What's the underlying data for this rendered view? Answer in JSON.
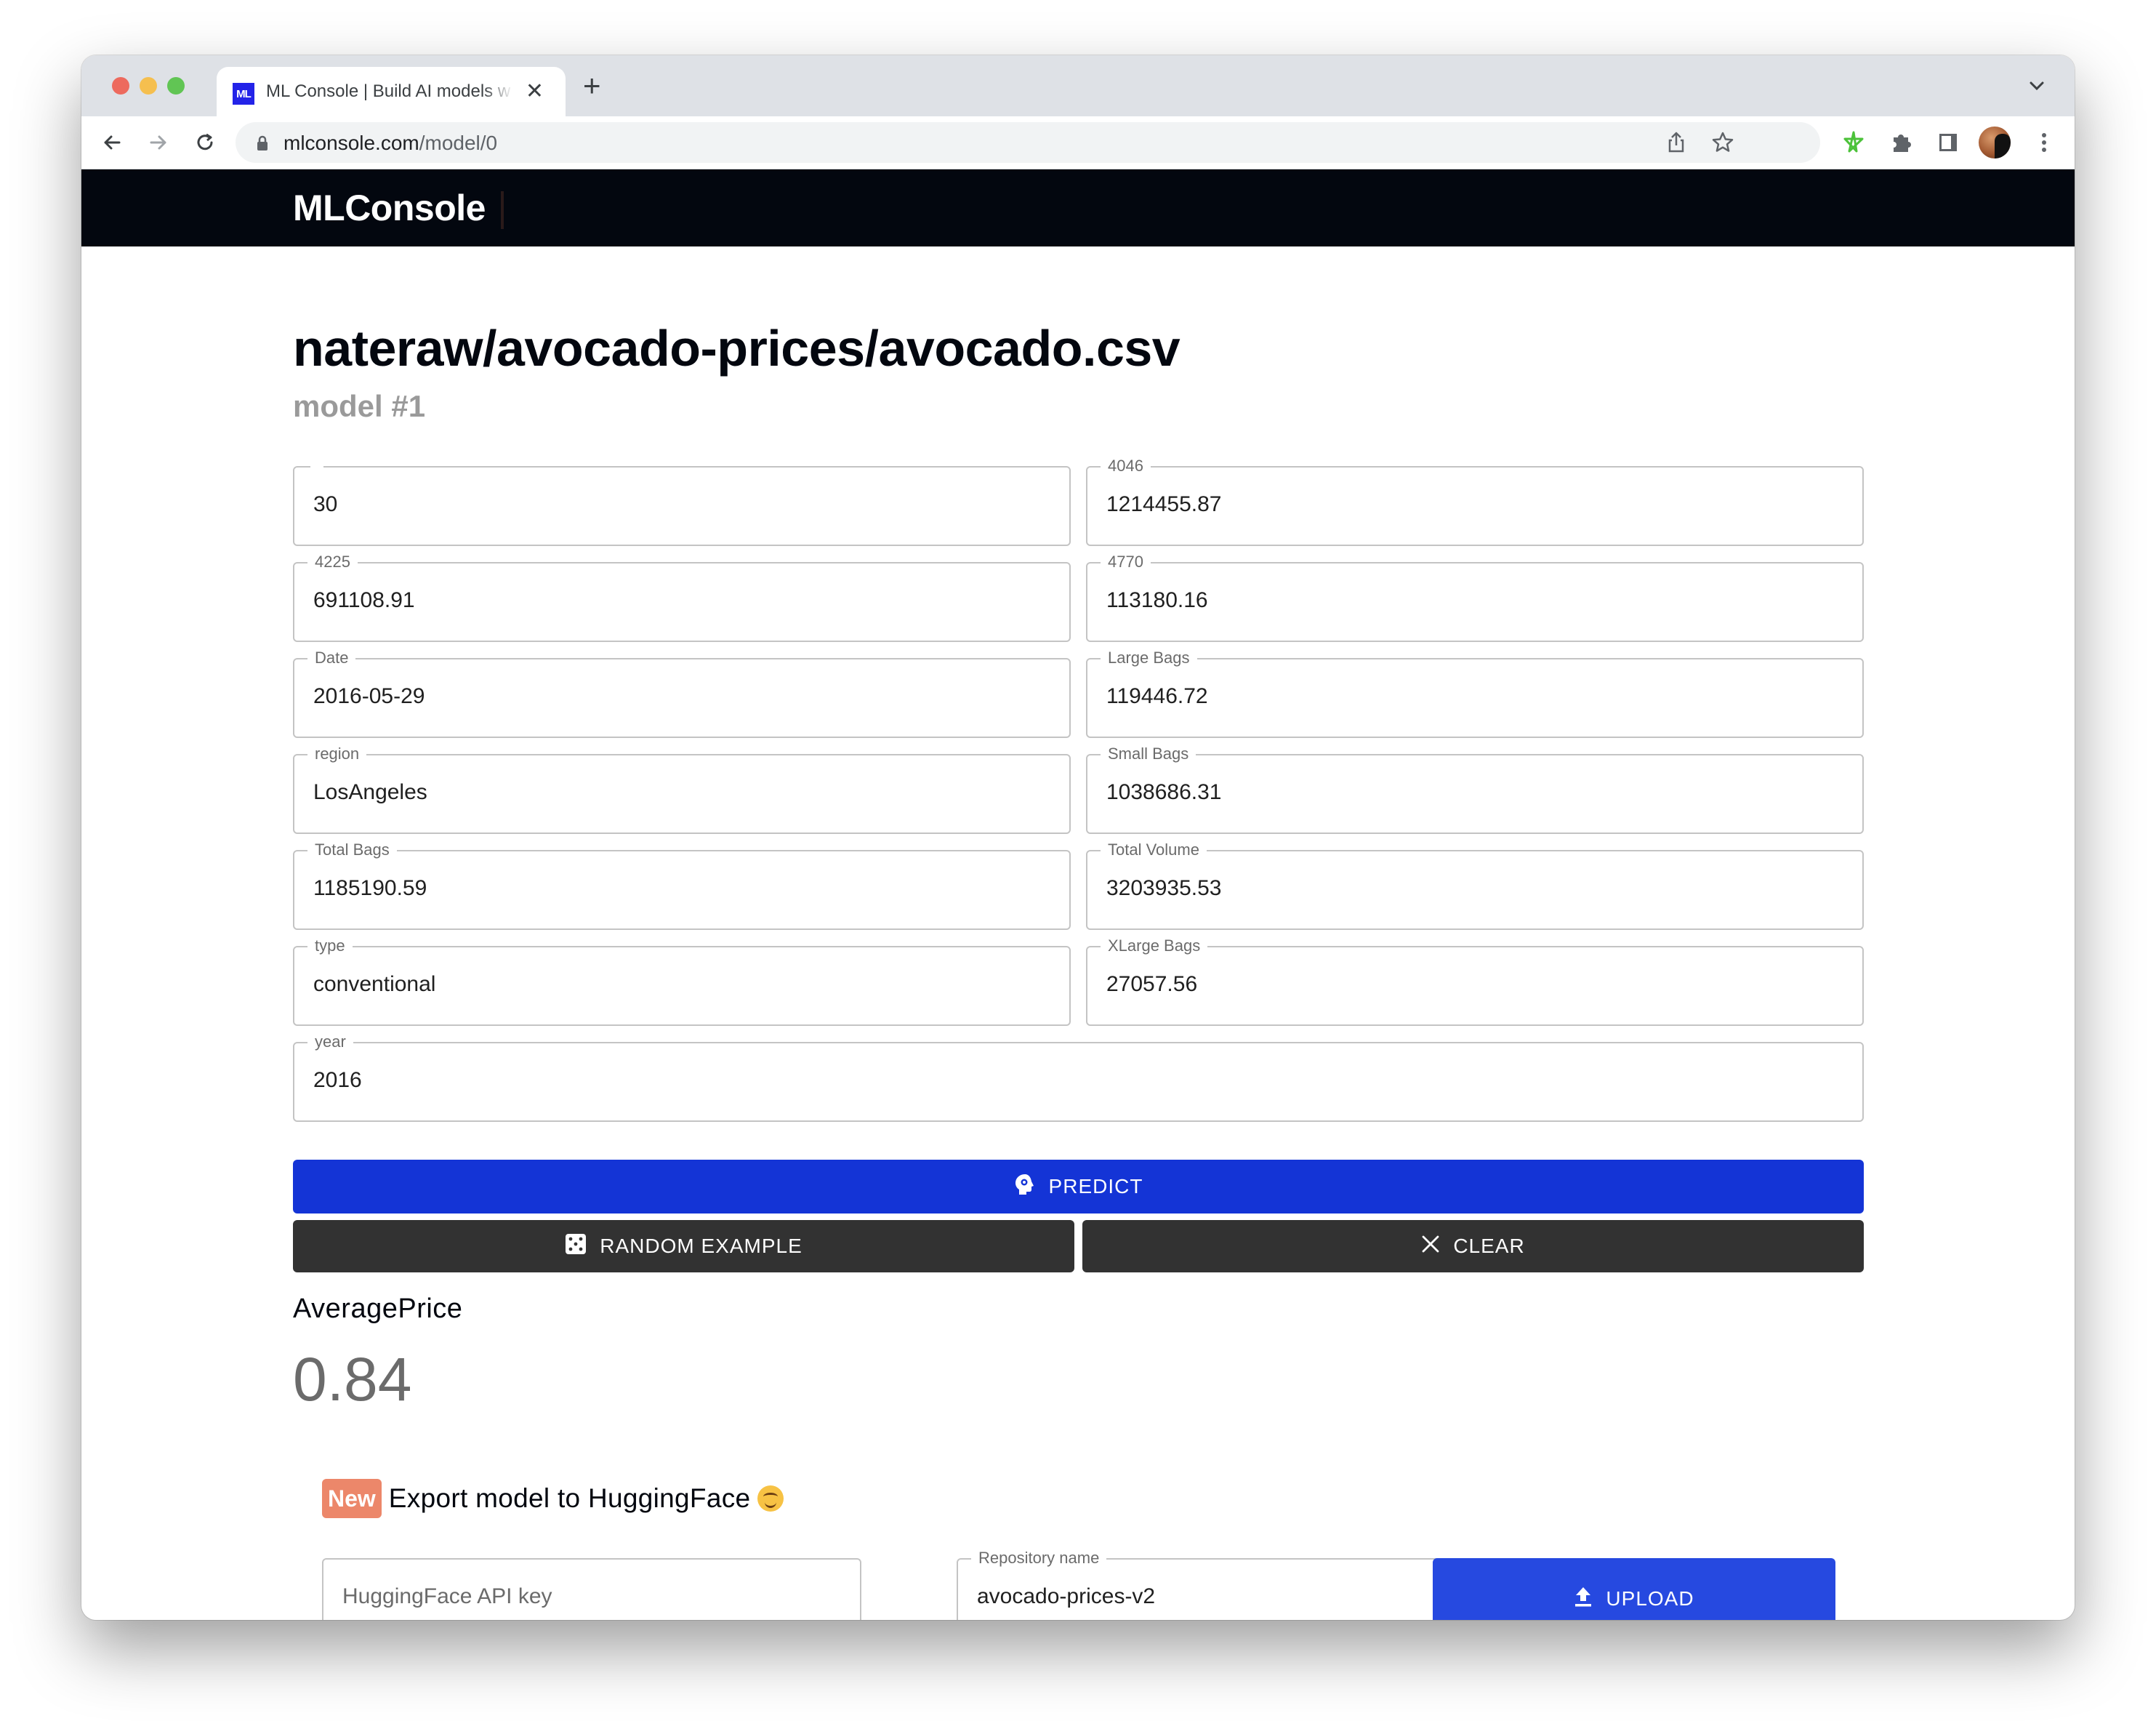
{
  "browser": {
    "tab": {
      "favicon_text": "ML",
      "title": "ML Console | Build AI models w",
      "close_glyph": "✕",
      "new_tab_glyph": "+"
    },
    "url": {
      "host": "mlconsole.com",
      "path": "/model/0"
    },
    "icons": [
      "back-icon",
      "forward-icon",
      "reload-icon",
      "lock-icon",
      "share-icon",
      "bookmark-star-icon",
      "extension-star-icon",
      "puzzle-extensions-icon",
      "side-panel-icon",
      "profile-avatar",
      "more-menu-icon",
      "tab-list-chevron-icon"
    ],
    "colors": {
      "tabstrip": "#dee1e6",
      "favicon": "#2323e8",
      "extension_green": "#4cc23a"
    }
  },
  "app": {
    "brand": "MLConsole",
    "header_bg": "#03070f"
  },
  "page": {
    "title": "nateraw/avocado-prices/avocado.csv",
    "subtitle": "model #1"
  },
  "fields": [
    {
      "label": "",
      "value": "30"
    },
    {
      "label": "4046",
      "value": "1214455.87"
    },
    {
      "label": "4225",
      "value": "691108.91"
    },
    {
      "label": "4770",
      "value": "113180.16"
    },
    {
      "label": "Date",
      "value": "2016-05-29"
    },
    {
      "label": "Large Bags",
      "value": "119446.72"
    },
    {
      "label": "region",
      "value": "LosAngeles"
    },
    {
      "label": "Small Bags",
      "value": "1038686.31"
    },
    {
      "label": "Total Bags",
      "value": "1185190.59"
    },
    {
      "label": "Total Volume",
      "value": "3203935.53"
    },
    {
      "label": "type",
      "value": "conventional"
    },
    {
      "label": "XLarge Bags",
      "value": "27057.56"
    },
    {
      "label": "year",
      "value": "2016"
    }
  ],
  "actions": {
    "predict_label": "PREDICT",
    "random_label": "RANDOM EXAMPLE",
    "clear_label": "CLEAR",
    "predict_color": "#1434d6",
    "secondary_color": "#323232"
  },
  "result": {
    "label": "AveragePrice",
    "value": "0.84"
  },
  "export": {
    "badge": "New",
    "badge_color": "#ec876a",
    "title": "Export model to HuggingFace",
    "emoji": "hugging-face-emoji",
    "api_key": {
      "label": "",
      "placeholder": "HuggingFace API key",
      "value": ""
    },
    "repo": {
      "label": "Repository name",
      "value": "avocado-prices-v2"
    },
    "upload_label": "UPLOAD",
    "upload_color": "#2649e0"
  }
}
